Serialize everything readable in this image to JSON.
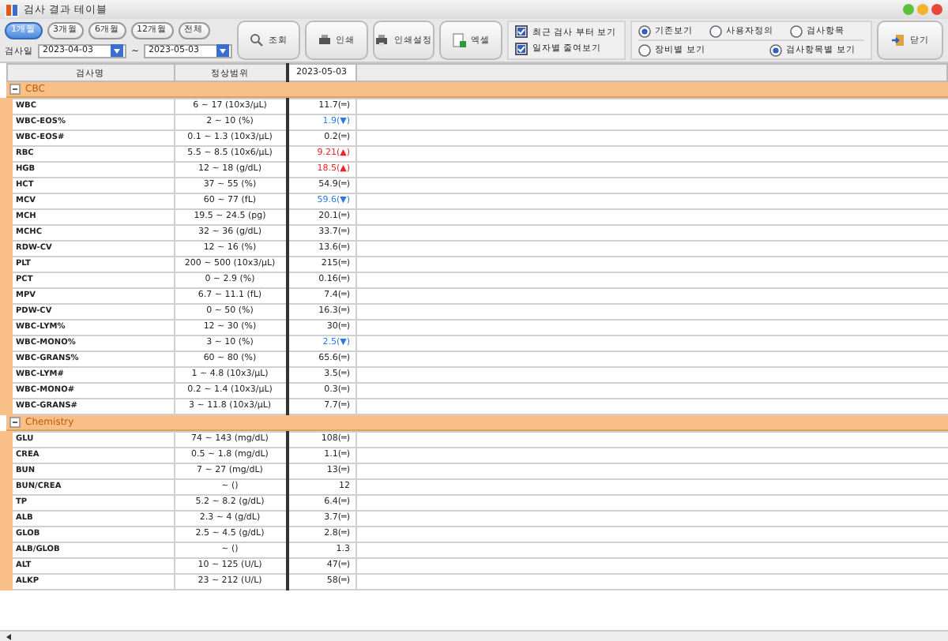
{
  "window": {
    "title": "검사 결과 테이블"
  },
  "periods": [
    {
      "label": "1개월",
      "selected": true
    },
    {
      "label": "3개월",
      "selected": false
    },
    {
      "label": "6개월",
      "selected": false
    },
    {
      "label": "12개월",
      "selected": false
    },
    {
      "label": "전체",
      "selected": false
    }
  ],
  "date_range": {
    "label": "검사일",
    "from": "2023-04-03",
    "separator": "~",
    "to": "2023-05-03"
  },
  "buttons": [
    {
      "label": "조회",
      "kind": "search"
    },
    {
      "label": "인쇄",
      "kind": "print"
    },
    {
      "label": "인쇄설정",
      "kind": "print-setup"
    },
    {
      "label": "엑셀",
      "kind": "excel"
    }
  ],
  "checkboxes": [
    {
      "label": "최근 검사 부터 보기",
      "checked": true
    },
    {
      "label": "일자별 줄여보기",
      "checked": true
    }
  ],
  "view_options": [
    {
      "label": "기존보기",
      "selected": true
    },
    {
      "label": "사용자정의",
      "selected": false
    },
    {
      "label": "검사항목",
      "selected": false
    }
  ],
  "group_options": [
    {
      "label": "장비별 보기",
      "selected": false
    },
    {
      "label": "검사항목별 보기",
      "selected": true
    }
  ],
  "close_button": {
    "label": "닫기"
  },
  "table": {
    "columns": [
      "검사명",
      "정상범위",
      "2023-05-03"
    ],
    "groups": [
      {
        "name": "CBC",
        "expanded": true,
        "rows": [
          {
            "name": "WBC",
            "range": "6 ~ 17 (10x3/μL)",
            "value": "11.7(═)",
            "color": "#222222"
          },
          {
            "name": "WBC-EOS%",
            "range": "2 ~ 10 (%)",
            "value": "1.9(▼)",
            "color": "#2a7ae0"
          },
          {
            "name": "WBC-EOS#",
            "range": "0.1 ~ 1.3 (10x3/μL)",
            "value": "0.2(═)",
            "color": "#222222"
          },
          {
            "name": "RBC",
            "range": "5.5 ~ 8.5 (10x6/μL)",
            "value": "9.21(▲)",
            "color": "#ee2222"
          },
          {
            "name": "HGB",
            "range": "12 ~ 18 (g/dL)",
            "value": "18.5(▲)",
            "color": "#ee2222"
          },
          {
            "name": "HCT",
            "range": "37 ~ 55 (%)",
            "value": "54.9(═)",
            "color": "#222222"
          },
          {
            "name": "MCV",
            "range": "60 ~ 77 (fL)",
            "value": "59.6(▼)",
            "color": "#2a7ae0"
          },
          {
            "name": "MCH",
            "range": "19.5 ~ 24.5 (pg)",
            "value": "20.1(═)",
            "color": "#222222"
          },
          {
            "name": "MCHC",
            "range": "32 ~ 36 (g/dL)",
            "value": "33.7(═)",
            "color": "#222222"
          },
          {
            "name": "RDW-CV",
            "range": "12 ~ 16 (%)",
            "value": "13.6(═)",
            "color": "#222222"
          },
          {
            "name": "PLT",
            "range": "200 ~ 500 (10x3/μL)",
            "value": "215(═)",
            "color": "#222222"
          },
          {
            "name": "PCT",
            "range": "0 ~ 2.9 (%)",
            "value": "0.16(═)",
            "color": "#222222"
          },
          {
            "name": "MPV",
            "range": "6.7 ~ 11.1 (fL)",
            "value": "7.4(═)",
            "color": "#222222"
          },
          {
            "name": "PDW-CV",
            "range": "0 ~ 50 (%)",
            "value": "16.3(═)",
            "color": "#222222"
          },
          {
            "name": "WBC-LYM%",
            "range": "12 ~ 30 (%)",
            "value": "30(═)",
            "color": "#222222"
          },
          {
            "name": "WBC-MONO%",
            "range": "3 ~ 10 (%)",
            "value": "2.5(▼)",
            "color": "#2a7ae0"
          },
          {
            "name": "WBC-GRANS%",
            "range": "60 ~ 80 (%)",
            "value": "65.6(═)",
            "color": "#222222"
          },
          {
            "name": "WBC-LYM#",
            "range": "1 ~ 4.8 (10x3/μL)",
            "value": "3.5(═)",
            "color": "#222222"
          },
          {
            "name": "WBC-MONO#",
            "range": "0.2 ~ 1.4 (10x3/μL)",
            "value": "0.3(═)",
            "color": "#222222"
          },
          {
            "name": "WBC-GRANS#",
            "range": "3 ~ 11.8 (10x3/μL)",
            "value": "7.7(═)",
            "color": "#222222"
          }
        ]
      },
      {
        "name": "Chemistry",
        "expanded": true,
        "rows": [
          {
            "name": "GLU",
            "range": "74 ~ 143 (mg/dL)",
            "value": "108(═)",
            "color": "#222222"
          },
          {
            "name": "CREA",
            "range": "0.5 ~ 1.8 (mg/dL)",
            "value": "1.1(═)",
            "color": "#222222"
          },
          {
            "name": "BUN",
            "range": "7 ~ 27 (mg/dL)",
            "value": "13(═)",
            "color": "#222222"
          },
          {
            "name": "BUN/CREA",
            "range": "~ ()",
            "value": "12",
            "color": "#222222"
          },
          {
            "name": "TP",
            "range": "5.2 ~ 8.2 (g/dL)",
            "value": "6.4(═)",
            "color": "#222222"
          },
          {
            "name": "ALB",
            "range": "2.3 ~ 4 (g/dL)",
            "value": "3.7(═)",
            "color": "#222222"
          },
          {
            "name": "GLOB",
            "range": "2.5 ~ 4.5 (g/dL)",
            "value": "2.8(═)",
            "color": "#222222"
          },
          {
            "name": "ALB/GLOB",
            "range": "~ ()",
            "value": "1.3",
            "color": "#222222"
          },
          {
            "name": "ALT",
            "range": "10 ~ 125 (U/L)",
            "value": "47(═)",
            "color": "#222222"
          },
          {
            "name": "ALKP",
            "range": "23 ~ 212 (U/L)",
            "value": "58(═)",
            "color": "#222222"
          }
        ]
      }
    ]
  }
}
